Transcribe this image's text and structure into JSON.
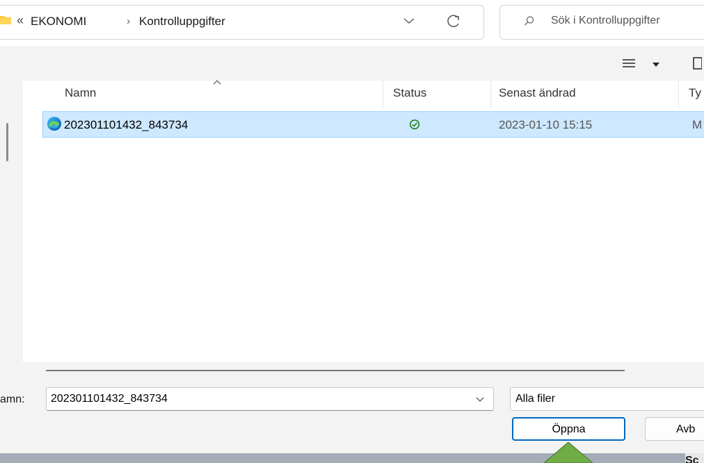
{
  "address": {
    "overflow_indicator": "«",
    "breadcrumb": [
      "EKONOMI",
      "Kontrolluppgifter"
    ],
    "separator": "›"
  },
  "search": {
    "placeholder": "Sök i Kontrolluppgifter"
  },
  "columns": {
    "name": "Namn",
    "status": "Status",
    "modified": "Senast ändrad",
    "type": "Ty"
  },
  "files": [
    {
      "name": "202301101432_843734",
      "status_icon": "synced-check-icon",
      "modified": "2023-01-10 15:15",
      "type": "M",
      "icon": "edge-icon",
      "selected": true
    }
  ],
  "bottom": {
    "filename_label": "amn:",
    "filename_value": "202301101432_843734",
    "filetype_label": "Alla filer",
    "open_label": "Öppna",
    "cancel_label": "Avb"
  },
  "background_window": {
    "text": "Sc"
  },
  "colors": {
    "selection_bg": "#cde8ff",
    "selection_border": "#99d1ff",
    "accent": "#0067c0",
    "status_green": "#0f7b0f",
    "folder_yellow": "#ffc83d",
    "annotation_green": "#70ad47"
  }
}
